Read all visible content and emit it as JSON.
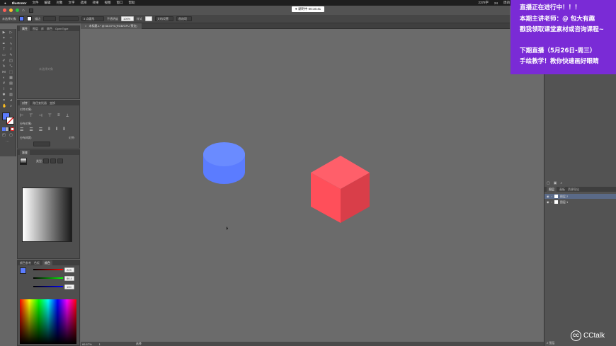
{
  "menubar": {
    "app_name": "Illustrator",
    "menus": [
      "文件",
      "编辑",
      "对象",
      "文字",
      "选择",
      "效果",
      "视图",
      "窗口",
      "帮助"
    ],
    "status_right": [
      "2378字",
      "24",
      "周四"
    ]
  },
  "toolbar": {
    "selection_label": "未选择对象",
    "stroke_label": "描边",
    "brush_value": "3 点圆形",
    "opacity_label": "不透明度",
    "opacity_value": "100%",
    "style_label": "样式",
    "doc_setup": "文档设置",
    "prefs": "首选项"
  },
  "timer": {
    "text": "● 录制中 00:16:41"
  },
  "document": {
    "tab_label": "未标题-1* @ 66.67% (RGB/GPU 预览)"
  },
  "panels": {
    "top": {
      "tabs": [
        "属性",
        "图层",
        "库",
        "颜色",
        "OpenType"
      ],
      "empty_note": "未选择对象"
    },
    "align": {
      "tabs": [
        "对齐",
        "路径查找器",
        "变换"
      ],
      "align_objects": "对齐对象:",
      "distribute_objects": "分布对象:",
      "distribute_spacing": "分布间距:",
      "align_to": "对齐:"
    },
    "gradient": {
      "tabs": [
        "渐变"
      ],
      "type_label": "类型:"
    },
    "color": {
      "tabs": [
        "颜色参考",
        "色板",
        "颜色"
      ],
      "r": "223",
      "g": "86.4",
      "b": "100"
    }
  },
  "layers": {
    "tabs": [
      "图层",
      "画板",
      "资源导出"
    ],
    "rows": [
      "图层 2",
      "图层 1"
    ],
    "footer": "2 图层"
  },
  "statusbar": {
    "zoom": "66.67%",
    "page": "1",
    "tool": "选择"
  },
  "overlay": {
    "line1": "直播正在进行中！！！",
    "line2": "本期主讲老师：@ 包大有趣",
    "line3": "戳我领取课堂素材或咨询课程~",
    "line4": "下期直播（5月26日-周三）",
    "line5": "手绘教学！教你快速画好眼睛"
  },
  "brand": {
    "name": "CCtalk"
  },
  "colors": {
    "cylinder": "#5b7cff",
    "cube_top": "#ff5f6a",
    "cube_left": "#ff4f5a",
    "cube_right": "#d93e49",
    "overlay": "#7a2bd6"
  }
}
